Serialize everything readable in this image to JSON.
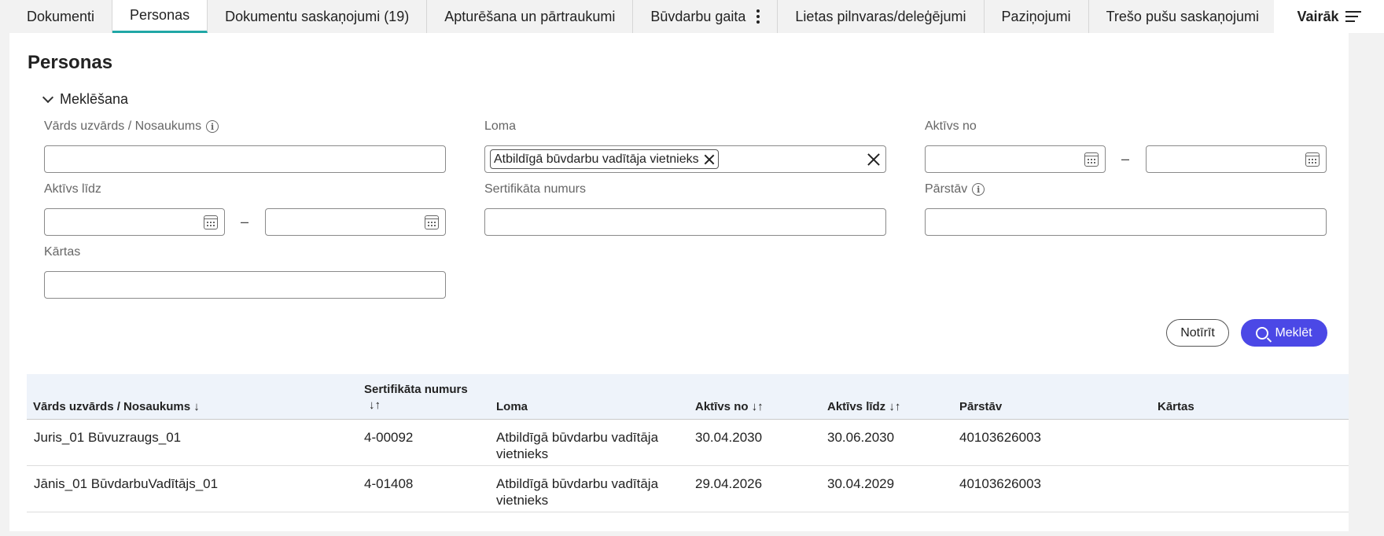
{
  "tabs": [
    {
      "label": "Dokumenti"
    },
    {
      "label": "Personas"
    },
    {
      "label": "Dokumentu saskaņojumi (19)"
    },
    {
      "label": "Apturēšana un pārtraukumi"
    },
    {
      "label": "Būvdarbu gaita"
    },
    {
      "label": "Lietas pilnvaras/deleģējumi"
    },
    {
      "label": "Paziņojumi"
    },
    {
      "label": "Trešo pušu saskaņojumi"
    }
  ],
  "more_label": "Vairāk",
  "page_title": "Personas",
  "search": {
    "toggle_label": "Meklēšana",
    "name_label": "Vārds uzvārds / Nosaukums",
    "role_label": "Loma",
    "role_chip": "Atbildīgā būvdarbu vadītāja vietnieks",
    "active_from_label": "Aktīvs no",
    "active_to_label": "Aktīvs līdz",
    "cert_label": "Sertifikāta numurs",
    "represents_label": "Pārstāv",
    "orders_label": "Kārtas",
    "range_separator": "–",
    "clear_label": "Notīrīt",
    "search_label": "Meklēt"
  },
  "table": {
    "headers": {
      "name": "Vārds uzvārds / Nosaukums ↓",
      "cert_line1": "Sertifikāta numurs",
      "cert_line2": "↓↑",
      "role": "Loma",
      "active_from": "Aktīvs no ↓↑",
      "active_to": "Aktīvs līdz ↓↑",
      "represents": "Pārstāv",
      "orders": "Kārtas"
    },
    "rows": [
      {
        "name": "Juris_01 Būvuzraugs_01",
        "cert": "4-00092",
        "role_line1": "Atbildīgā būvdarbu vadītāja",
        "role_line2": "vietnieks",
        "active_from": "30.04.2030",
        "active_to": "30.06.2030",
        "represents": "40103626003",
        "orders": ""
      },
      {
        "name": "Jānis_01 BūvdarbuVadītājs_01",
        "cert": "4-01408",
        "role_line1": "Atbildīgā būvdarbu vadītāja",
        "role_line2": "vietnieks",
        "active_from": "29.04.2026",
        "active_to": "30.04.2029",
        "represents": "40103626003",
        "orders": ""
      }
    ]
  },
  "colors": {
    "accent_tab": "#20a7a6",
    "primary_button": "#4b48e6",
    "table_header_bg": "#eef3fa"
  },
  "icons": [
    "info-icon",
    "calendar-icon",
    "close-icon",
    "search-icon",
    "menu-icon",
    "kebab-icon",
    "chevron-down-icon"
  ]
}
